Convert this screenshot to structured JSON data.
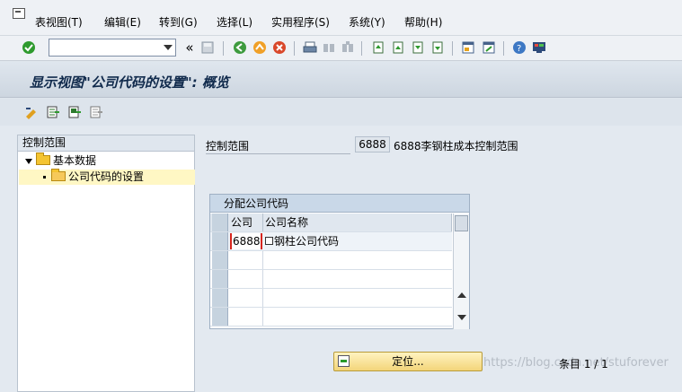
{
  "menu": [
    "表视图(T)",
    "编辑(E)",
    "转到(G)",
    "选择(L)",
    "实用程序(S)",
    "系统(Y)",
    "帮助(H)"
  ],
  "toolbar": {
    "command_value": "",
    "nav_back_symbol": "«"
  },
  "title": "显示视图\"公司代码的设置\": 概览",
  "tree": {
    "header": "控制范围",
    "items": [
      {
        "label": "基本数据"
      },
      {
        "label": "公司代码的设置"
      }
    ]
  },
  "control_area": {
    "label": "控制范围",
    "value": "6888",
    "description": "6888李钢柱成本控制范围"
  },
  "assign_table": {
    "title": "分配公司代码",
    "columns": [
      "公司",
      "公司名称"
    ],
    "rows": [
      {
        "company": "6888",
        "name": "钢柱公司代码"
      }
    ]
  },
  "position_button": "定位...",
  "entry_info": "条目 1 / 1",
  "watermark": "https://blog.csdn.net/stuforever",
  "colors": {
    "title": "#102a4c",
    "selection": "#fff7c4",
    "required_marker": "#d7261e"
  }
}
